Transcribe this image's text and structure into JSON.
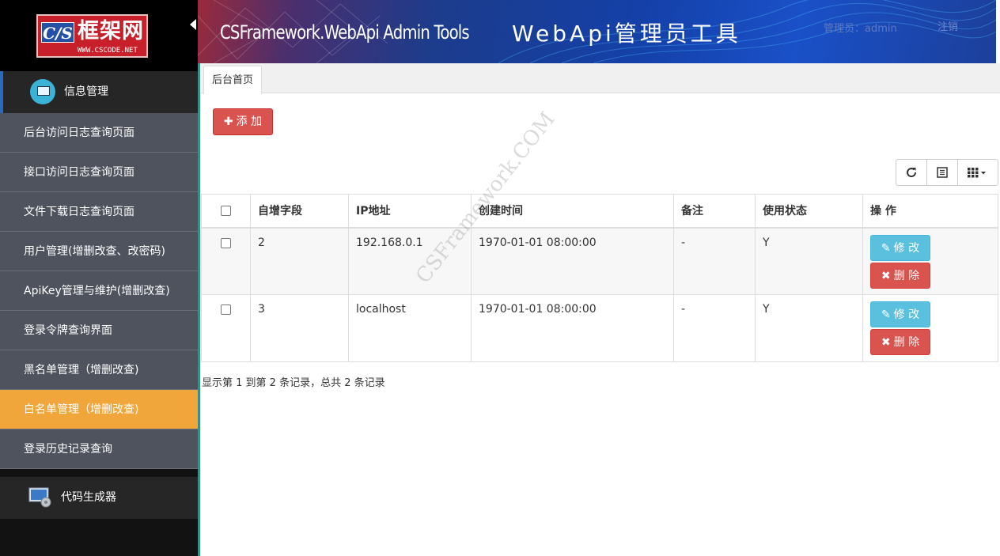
{
  "logo": {
    "badge": "C/S",
    "name": "框架网",
    "url": "WWW.CSCODE.NET"
  },
  "header": {
    "title_en": "CSFramework.WebApi Admin Tools",
    "title_cn": "WebApi管理员工具",
    "admin_label": "管理员：admin",
    "logout": "注销"
  },
  "sidebar": {
    "group1": "信息管理",
    "items": [
      {
        "label": "后台访问日志查询页面"
      },
      {
        "label": "接口访问日志查询页面"
      },
      {
        "label": "文件下载日志查询页面"
      },
      {
        "label": "用户管理(增删改查、改密码)"
      },
      {
        "label": "ApiKey管理与维护(增删改查)"
      },
      {
        "label": "登录令牌查询界面"
      },
      {
        "label": "黑名单管理（增删改查)"
      },
      {
        "label": "白名单管理（增删改查)"
      },
      {
        "label": "登录历史记录查询"
      }
    ],
    "active_index": 7,
    "group2": "代码生成器"
  },
  "tabs": [
    {
      "label": "后台首页"
    }
  ],
  "toolbar": {
    "add_label": "添 加"
  },
  "table": {
    "columns": [
      "自增字段",
      "IP地址",
      "创建时间",
      "备注",
      "使用状态",
      "操 作"
    ],
    "rows": [
      {
        "id": "2",
        "ip": "192.168.0.1",
        "created": "1970-01-01 08:00:00",
        "remark": "-",
        "status": "Y"
      },
      {
        "id": "3",
        "ip": "localhost",
        "created": "1970-01-01 08:00:00",
        "remark": "-",
        "status": "Y"
      }
    ],
    "edit_label": "修 改",
    "delete_label": "删 除"
  },
  "pager": {
    "info": "显示第 1 到第 2 条记录，总共 2 条记录"
  },
  "watermark": "CSFramework.COM",
  "colors": {
    "accent_red": "#d9534f",
    "accent_info": "#5bc0de",
    "active_menu": "#f0a63a",
    "menu_bg": "#4e535e"
  }
}
